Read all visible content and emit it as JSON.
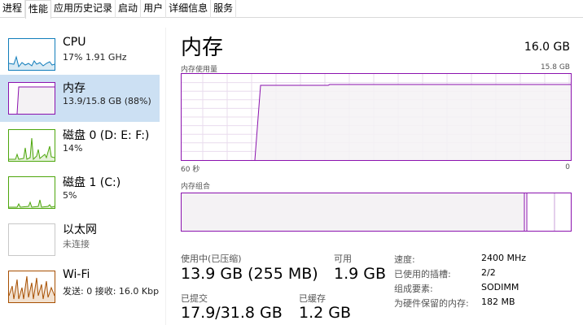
{
  "tabs": [
    "进程",
    "性能",
    "应用历史记录",
    "启动",
    "用户",
    "详细信息",
    "服务"
  ],
  "active_tab": 1,
  "sidebar": {
    "items": [
      {
        "title": "CPU",
        "subtitle": "17% 1.91 GHz",
        "color": "#117dbb",
        "icon": "cpu-graph-icon"
      },
      {
        "title": "内存",
        "subtitle": "13.9/15.8 GB (88%)",
        "color": "#8b12ae",
        "icon": "memory-graph-icon"
      },
      {
        "title": "磁盘 0 (D: E: F:)",
        "subtitle": "14%",
        "color": "#4da60c",
        "icon": "disk0-graph-icon"
      },
      {
        "title": "磁盘 1 (C:)",
        "subtitle": "5%",
        "color": "#4da60c",
        "icon": "disk1-graph-icon"
      },
      {
        "title": "以太网",
        "subtitle": "未连接",
        "color": "#a7a7a7",
        "icon": "ethernet-graph-icon"
      },
      {
        "title": "Wi-Fi",
        "subtitle": "发送: 0 接收: 16.0 Kbp",
        "color": "#a74f01",
        "icon": "wifi-graph-icon"
      }
    ],
    "selected": 1
  },
  "main": {
    "title": "内存",
    "total": "16.0 GB",
    "usage_graph_label": "内存使用量",
    "usage_graph_max": "15.8 GB",
    "time_left": "60 秒",
    "time_right": "0",
    "composition_label": "内存组合",
    "stats": {
      "in_use_label": "使用中(已压缩)",
      "in_use_value": "13.9 GB (255 MB)",
      "available_label": "可用",
      "available_value": "1.9 GB",
      "committed_label": "已提交",
      "committed_value": "17.9/31.8 GB",
      "cached_label": "已缓存",
      "cached_value": "1.2 GB"
    },
    "details": [
      {
        "label": "速度:",
        "value": "2400 MHz"
      },
      {
        "label": "已使用的插槽:",
        "value": "2/2"
      },
      {
        "label": "组成要素:",
        "value": "SODIMM"
      },
      {
        "label": "为硬件保留的内存:",
        "value": "182 MB"
      }
    ]
  },
  "colors": {
    "memory_accent": "#8b12ae",
    "memory_fill": "#f4f2f4",
    "selected_bg": "#cce0f3"
  }
}
